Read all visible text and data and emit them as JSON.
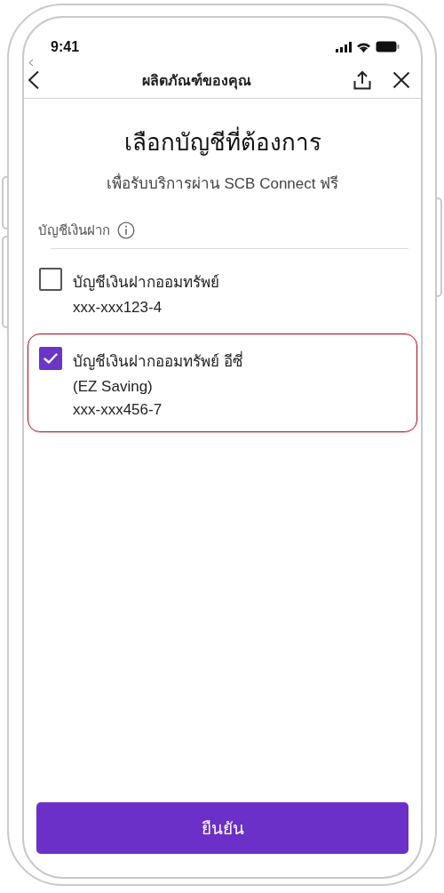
{
  "status_bar": {
    "time": "9:41"
  },
  "nav": {
    "title": "ผลิตภัณฑ์ของคุณ"
  },
  "heading": "เลือกบัญชีที่ต้องการ",
  "subheading": "เพื่อรับบริการผ่าน SCB Connect ฟรี",
  "section": {
    "label": "บัญชีเงินฝาก"
  },
  "accounts": [
    {
      "name": "บัญชีเงินฝากออมทรัพย์",
      "number": "xxx-xxx123-4",
      "checked": false
    },
    {
      "name": "บัญชีเงินฝากออมทรัพย์ อีซี่",
      "subtitle": "(EZ Saving)",
      "number": "xxx-xxx456-7",
      "checked": true
    }
  ],
  "confirm_button": {
    "label": "ยืนยัน"
  }
}
